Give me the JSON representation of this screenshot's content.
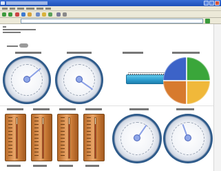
{
  "window": {
    "title": ""
  },
  "gauges": [
    {
      "label": "",
      "value": 62
    },
    {
      "label": "",
      "value": 38
    },
    {
      "label": "",
      "value": 70
    },
    {
      "label": "",
      "value": 45
    }
  ],
  "linear_gauge": {
    "label": "",
    "value": 100
  },
  "pie": {
    "label": "",
    "slices": [
      "#3aa63a",
      "#f0b83a",
      "#d77a2e",
      "#3c63c8"
    ]
  },
  "thermometers": [
    {
      "label": "",
      "value": 0.85
    },
    {
      "label": "",
      "value": 0.85
    },
    {
      "label": "",
      "value": 0.85
    },
    {
      "label": "",
      "value": 0.85
    }
  ],
  "icons": {
    "back": "back-icon",
    "forward": "forward-icon",
    "refresh": "refresh-icon",
    "home": "home-icon",
    "go": "go-icon"
  }
}
